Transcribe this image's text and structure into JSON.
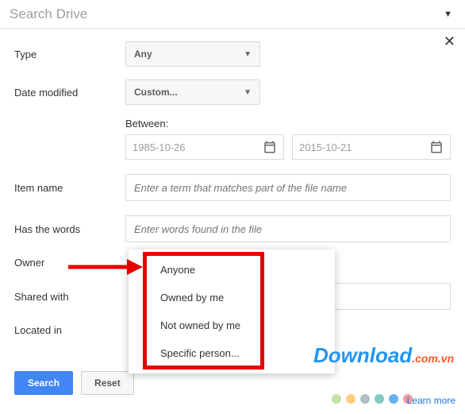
{
  "search": {
    "placeholder": "Search Drive"
  },
  "close": "✕",
  "type": {
    "label": "Type",
    "value": "Any"
  },
  "dateModified": {
    "label": "Date modified",
    "value": "Custom..."
  },
  "between": {
    "label": "Between:",
    "from": "1985-10-26",
    "to": "2015-10-21"
  },
  "itemName": {
    "label": "Item name",
    "placeholder": "Enter a term that matches part of the file name"
  },
  "hasWords": {
    "label": "Has the words",
    "placeholder": "Enter words found in the file"
  },
  "owner": {
    "label": "Owner",
    "options": [
      "Anyone",
      "Owned by me",
      "Not owned by me",
      "Specific person..."
    ]
  },
  "sharedWith": {
    "label": "Shared with"
  },
  "locatedIn": {
    "label": "Located in"
  },
  "buttons": {
    "search": "Search",
    "reset": "Reset"
  },
  "learnMore": "Learn more",
  "watermark": {
    "brand": "Download",
    "suffix": ".com.vn",
    "brandColor": "#2196f3",
    "suffixColor": "#ff5722"
  }
}
